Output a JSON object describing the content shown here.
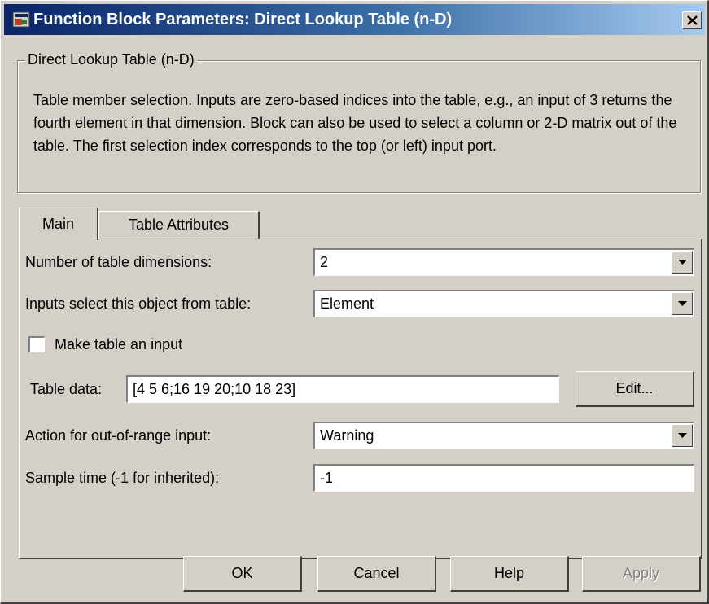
{
  "window": {
    "title": "Function Block Parameters: Direct Lookup Table (n-D)"
  },
  "description": {
    "group_title": "Direct Lookup Table (n-D)",
    "text": "Table member selection.  Inputs are zero-based indices into the table, e.g., an input of 3 returns the fourth element in that dimension. Block can also be used to select a column or 2-D matrix out of the table. The first selection index corresponds to the top (or left) input port."
  },
  "tabs": [
    {
      "label": "Main",
      "selected": true
    },
    {
      "label": "Table Attributes",
      "selected": false
    }
  ],
  "params": {
    "num_dims": {
      "label": "Number of table dimensions:",
      "value": "2"
    },
    "select_object": {
      "label": "Inputs select this object from table:",
      "value": "Element"
    },
    "make_input": {
      "label": "Make table an input",
      "checked": false
    },
    "table_data": {
      "label": "Table data:",
      "value": "[4 5 6;16 19 20;10 18 23]",
      "edit_label": "Edit..."
    },
    "out_of_range": {
      "label": "Action for out-of-range input:",
      "value": "Warning"
    },
    "sample_time": {
      "label": "Sample time (-1 for inherited):",
      "value": "-1"
    }
  },
  "buttons": {
    "ok": "OK",
    "cancel": "Cancel",
    "help": "Help",
    "apply": "Apply"
  },
  "icons": {
    "app": "simulink-block-icon",
    "close": "close-icon",
    "dropdown": "chevron-down-icon"
  }
}
